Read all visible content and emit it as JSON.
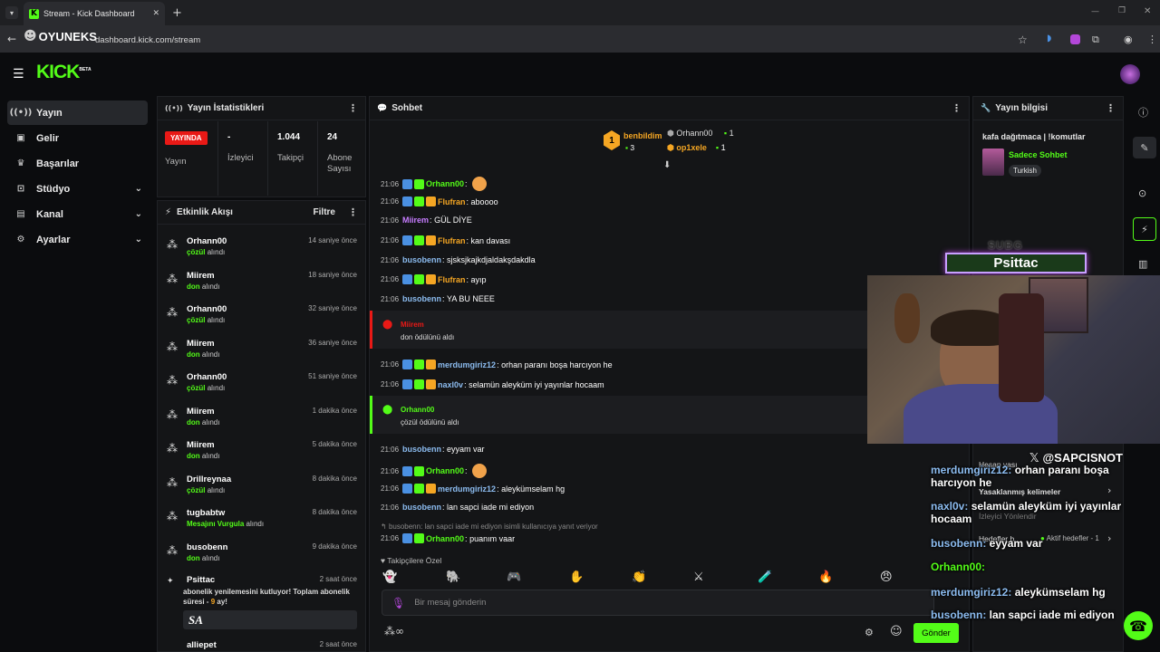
{
  "browser": {
    "tab_title": "Stream - Kick Dashboard",
    "url": "dashboard.kick.com/stream",
    "watermark": "OYUNEKS"
  },
  "brand": {
    "logo": "KICK",
    "beta": "BETA",
    "accent": "#53fc18"
  },
  "sidebar": {
    "items": [
      {
        "label": "Yayın",
        "icon": "broadcast-icon",
        "active": true
      },
      {
        "label": "Gelir",
        "icon": "wallet-icon"
      },
      {
        "label": "Başarılar",
        "icon": "trophy-icon"
      },
      {
        "label": "Stüdyo",
        "icon": "studio-icon",
        "expandable": true
      },
      {
        "label": "Kanal",
        "icon": "channel-icon",
        "expandable": true
      },
      {
        "label": "Ayarlar",
        "icon": "gear-icon",
        "expandable": true
      }
    ]
  },
  "stats": {
    "title": "Yayın İstatistikleri",
    "live_badge": "YAYINDA",
    "live_label": "Yayın",
    "viewers_value": "-",
    "viewers_label": "İzleyici",
    "followers_value": "1.044",
    "followers_label": "Takipçi",
    "subs_value": "24",
    "subs_label": "Abone Sayısı"
  },
  "activity": {
    "title": "Etkinlik Akışı",
    "filter": "Filtre",
    "items": [
      {
        "name": "Orhann00",
        "reward": "çözül",
        "suffix": "alındı",
        "time": "14 saniye önce"
      },
      {
        "name": "Miirem",
        "reward": "don",
        "suffix": "alındı",
        "time": "18 saniye önce"
      },
      {
        "name": "Orhann00",
        "reward": "çözül",
        "suffix": "alındı",
        "time": "32 saniye önce"
      },
      {
        "name": "Miirem",
        "reward": "don",
        "suffix": "alındı",
        "time": "36 saniye önce"
      },
      {
        "name": "Orhann00",
        "reward": "çözül",
        "suffix": "alındı",
        "time": "51 saniye önce"
      },
      {
        "name": "Miirem",
        "reward": "don",
        "suffix": "alındı",
        "time": "1 dakika önce"
      },
      {
        "name": "Miirem",
        "reward": "don",
        "suffix": "alındı",
        "time": "5 dakika önce"
      },
      {
        "name": "Drillreynaa",
        "reward": "çözül",
        "suffix": "alındı",
        "time": "8 dakika önce"
      },
      {
        "name": "tugbabtw",
        "reward": "Mesajını Vurgula",
        "suffix": "alındı",
        "time": "8 dakika önce"
      },
      {
        "name": "busobenn",
        "reward": "don",
        "suffix": "alındı",
        "time": "9 dakika önce"
      }
    ],
    "sub_item": {
      "name": "Psittac",
      "time": "2 saat önce",
      "text": "abonelik yenilemesini kutluyor! Toplam abonelik süresi -",
      "months": "9",
      "ay": "ay!",
      "message": "SA"
    },
    "last_name": "alliepet",
    "last_time": "2 saat önce"
  },
  "chat": {
    "title": "Sohbet",
    "pinned": {
      "top1_name": "benbildim",
      "top1_count": "3",
      "top2_name": "Orhann00",
      "top2_count": "1",
      "top3_name": "op1xele",
      "top3_count": "1"
    },
    "messages": [
      {
        "time": "21:06",
        "user": "Orhann00",
        "text": "",
        "color": "#53fc18",
        "emote": true
      },
      {
        "time": "21:06",
        "user": "Flufran",
        "text": "aboooo",
        "color": "#f5a623"
      },
      {
        "time": "21:06",
        "user": "Miirem",
        "text": "GÜL DİYE",
        "color": "#c77dff"
      },
      {
        "time": "21:06",
        "user": "Flufran",
        "text": "kan davası",
        "color": "#f5a623"
      },
      {
        "time": "21:06",
        "user": "busobenn",
        "text": "sjsksjkajkdjaldakşdakdla",
        "color": "#8cbcf0"
      },
      {
        "time": "21:06",
        "user": "Flufran",
        "text": "ayıp",
        "color": "#f5a623"
      },
      {
        "time": "21:06",
        "user": "busobenn",
        "text": "YA BU NEEE",
        "color": "#8cbcf0"
      },
      {
        "time": "21:06",
        "user": "merdumgiriz12",
        "text": "orhan paranı boşa harcıyon he",
        "color": "#8cbcf0"
      },
      {
        "time": "21:06",
        "user": "naxl0v",
        "text": "selamün aleyküm iyi yayınlar hocaam",
        "color": "#8cbcf0"
      },
      {
        "time": "21:06",
        "user": "busobenn",
        "text": "eyyam var",
        "color": "#8cbcf0"
      },
      {
        "time": "21:06",
        "user": "Orhann00",
        "text": "",
        "color": "#53fc18",
        "emote": true
      },
      {
        "time": "21:06",
        "user": "merdumgiriz12",
        "text": "aleykümselam hg",
        "color": "#8cbcf0"
      },
      {
        "time": "21:06",
        "user": "busobenn",
        "text": "lan sapci iade mi ediyon",
        "color": "#8cbcf0"
      },
      {
        "time": "21:06",
        "user": "Orhann00",
        "text": "puanım vaar",
        "color": "#53fc18"
      }
    ],
    "reward1": {
      "user": "Miirem",
      "text": "don ödülünü aldı",
      "color": "#e91916"
    },
    "reward2": {
      "user": "Orhann00",
      "text": "çözül ödülünü aldı",
      "color": "#53fc18"
    },
    "reply_note": "busobenn: lan sapci iade mi ediyon isimli kullanıcıya yanıt veriyor",
    "followers_only": "Takipçilere Özel",
    "input_placeholder": "Bir mesaj gönderin",
    "send_label": "Gönder"
  },
  "stream_info": {
    "title": "Yayın bilgisi",
    "stream_title": "kafa dağıtmaca | !komutlar",
    "category": "Sadece Sohbet",
    "language": "Turkish",
    "sub_label": "SUBG",
    "sub_name": "Psittac"
  },
  "overlay": {
    "social": "@SAPCISNOT",
    "under1": "Hesap yası",
    "under2": "Yasaklanmış kelimeler",
    "under3": "İzleyici Yönlendir",
    "under4": "Hedefler b",
    "under5": "Aktif hedefler - 1",
    "lines": [
      {
        "user": "merdumgiriz12:",
        "text": "orhan paranı boşa harcıyon he"
      },
      {
        "user": "naxl0v:",
        "text": "selamün aleyküm iyi yayınlar hocaam"
      },
      {
        "user": "busobenn:",
        "text": "eyyam var"
      },
      {
        "user": "Orhann00:",
        "text": ""
      },
      {
        "user": "merdumgiriz12:",
        "text": "aleykümselam hg"
      },
      {
        "user": "busobenn:",
        "text": "lan sapci iade mi ediyon"
      }
    ]
  }
}
